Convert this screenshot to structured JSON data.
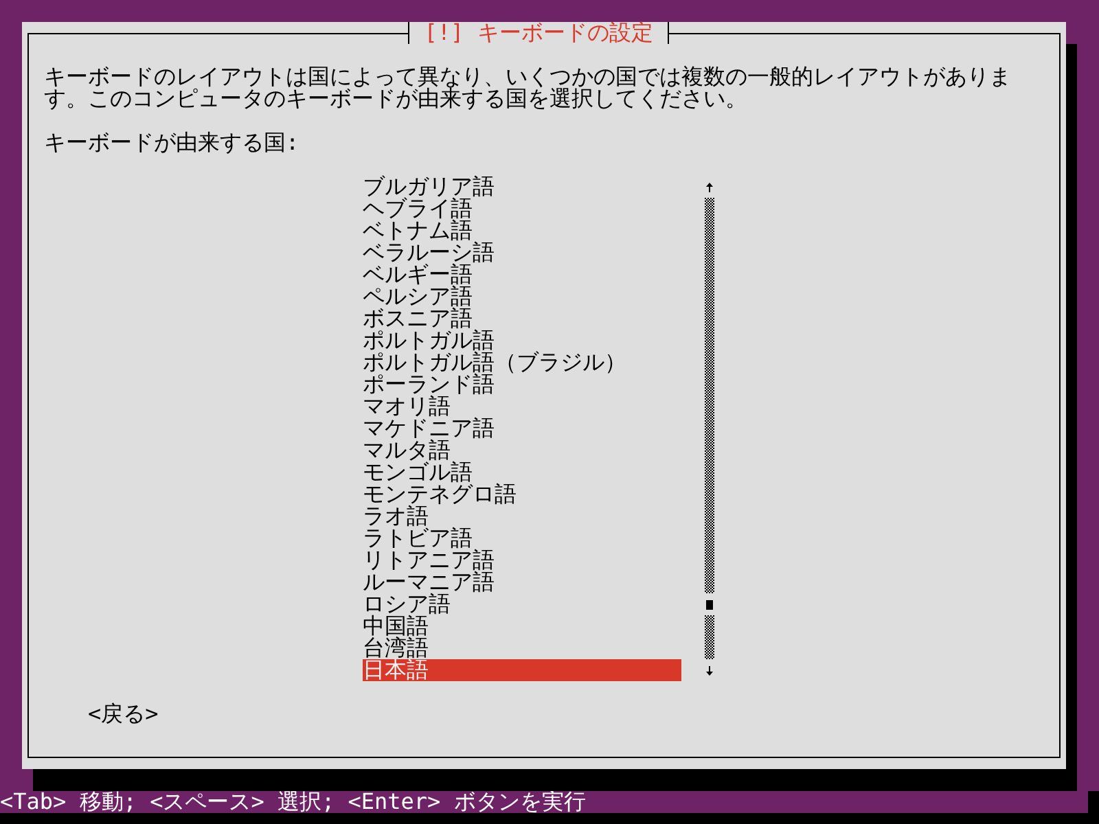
{
  "dialog": {
    "title": "[!] キーボードの設定",
    "description": "キーボードのレイアウトは国によって異なり、いくつかの国では複数の一般的レイアウトがあります。このコンピュータのキーボードが由来する国を選択してください。",
    "prompt": "キーボードが由来する国:",
    "options": [
      {
        "label": "ブルガリア語",
        "selected": false
      },
      {
        "label": "ヘブライ語",
        "selected": false
      },
      {
        "label": "ベトナム語",
        "selected": false
      },
      {
        "label": "ベラルーシ語",
        "selected": false
      },
      {
        "label": "ベルギー語",
        "selected": false
      },
      {
        "label": "ペルシア語",
        "selected": false
      },
      {
        "label": "ボスニア語",
        "selected": false
      },
      {
        "label": "ポルトガル語",
        "selected": false
      },
      {
        "label": "ポルトガル語（ブラジル）",
        "selected": false
      },
      {
        "label": "ポーランド語",
        "selected": false
      },
      {
        "label": "マオリ語",
        "selected": false
      },
      {
        "label": "マケドニア語",
        "selected": false
      },
      {
        "label": "マルタ語",
        "selected": false
      },
      {
        "label": "モンゴル語",
        "selected": false
      },
      {
        "label": "モンテネグロ語",
        "selected": false
      },
      {
        "label": "ラオ語",
        "selected": false
      },
      {
        "label": "ラトビア語",
        "selected": false
      },
      {
        "label": "リトアニア語",
        "selected": false
      },
      {
        "label": "ルーマニア語",
        "selected": false
      },
      {
        "label": "ロシア語",
        "selected": false
      },
      {
        "label": "中国語",
        "selected": false
      },
      {
        "label": "台湾語",
        "selected": false
      },
      {
        "label": "日本語",
        "selected": true
      }
    ],
    "buttons": [
      {
        "label": "<戻る>"
      }
    ]
  },
  "status_bar": {
    "text": "<Tab> 移動; <スペース> 選択; <Enter> ボタンを実行"
  }
}
